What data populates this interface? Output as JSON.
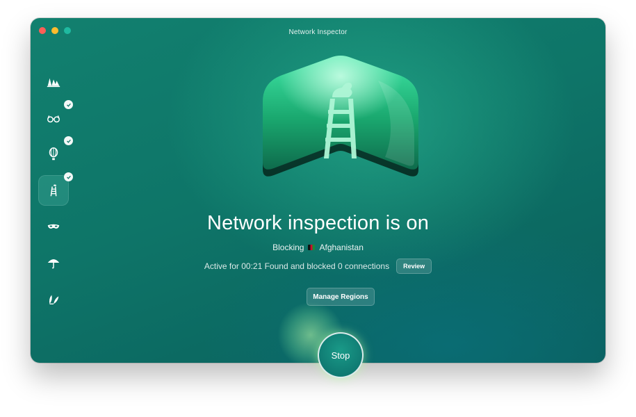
{
  "window": {
    "title": "Network Inspector"
  },
  "sidebar": {
    "items": [
      {
        "icon": "ships-icon",
        "checked": false,
        "active": false
      },
      {
        "icon": "glasses-icon",
        "checked": true,
        "active": false
      },
      {
        "icon": "balloon-icon",
        "checked": true,
        "active": false
      },
      {
        "icon": "ladder-icon",
        "checked": true,
        "active": true
      },
      {
        "icon": "mask-icon",
        "checked": false,
        "active": false
      },
      {
        "icon": "umbrella-icon",
        "checked": false,
        "active": false
      },
      {
        "icon": "leaves-icon",
        "checked": false,
        "active": false
      }
    ]
  },
  "main": {
    "headline": "Network inspection is on",
    "blocking_label": "Blocking",
    "blocking_country": "Afghanistan",
    "flag_icon": "afghanistan-flag-icon",
    "active_text": "Active for 00:21 Found and blocked 0 connections",
    "review_label": "Review",
    "manage_label": "Manage Regions",
    "stop_label": "Stop"
  },
  "colors": {
    "accent": "#0e7568",
    "glow": "#9cf5a8"
  }
}
